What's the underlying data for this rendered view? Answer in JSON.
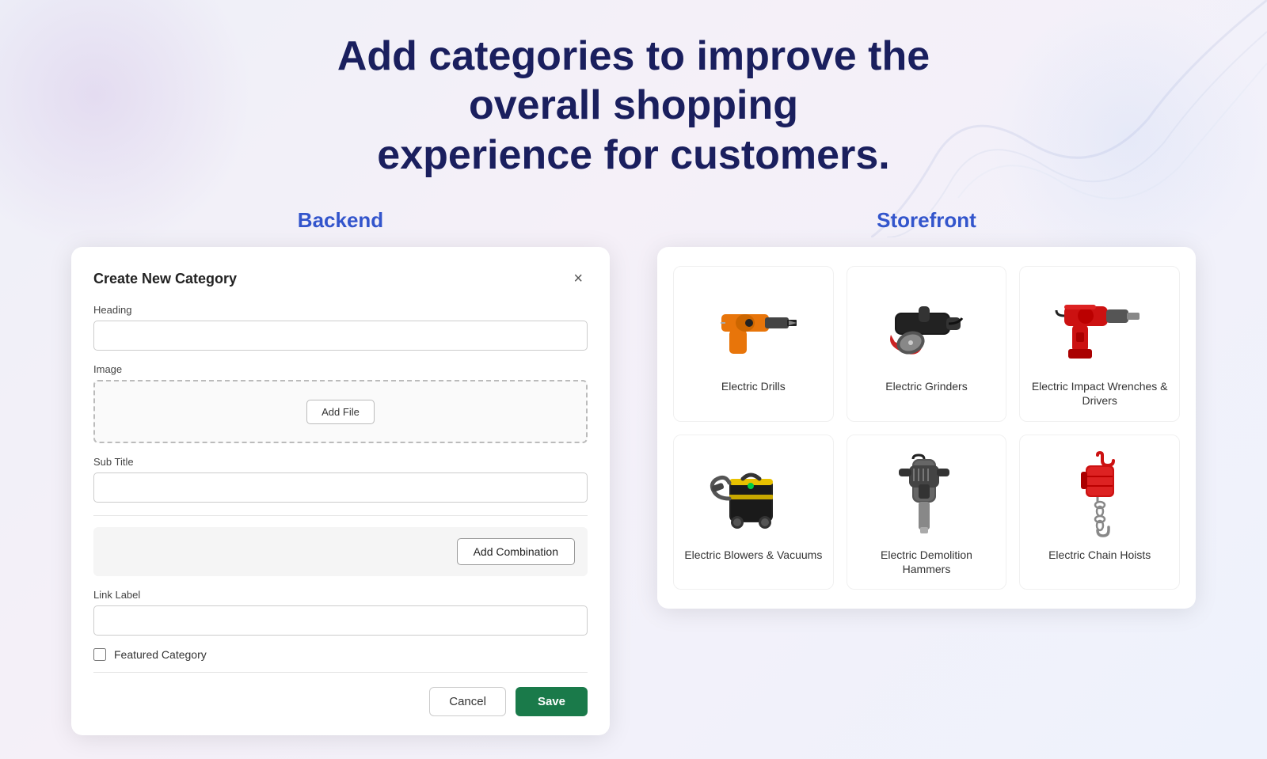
{
  "page": {
    "hero_title_line1": "Add categories to improve the overall shopping",
    "hero_title_line2": "experience for customers."
  },
  "backend": {
    "col_label": "Backend",
    "modal": {
      "title": "Create New Category",
      "heading_label": "Heading",
      "heading_placeholder": "",
      "image_label": "Image",
      "add_file_btn": "Add File",
      "subtitle_label": "Sub Title",
      "subtitle_placeholder": "",
      "add_combination_btn": "Add Combination",
      "link_label_label": "Link Label",
      "link_label_placeholder": "",
      "featured_label": "Featured Category",
      "cancel_btn": "Cancel",
      "save_btn": "Save"
    }
  },
  "storefront": {
    "col_label": "Storefront",
    "categories": [
      {
        "name": "Electric Drills",
        "tool": "drill"
      },
      {
        "name": "Electric Grinders",
        "tool": "grinder"
      },
      {
        "name": "Electric Impact Wrenches & Drivers",
        "tool": "impact_wrench"
      },
      {
        "name": "Electric Blowers & Vacuums",
        "tool": "vacuum"
      },
      {
        "name": "Electric Demolition Hammers",
        "tool": "demolition_hammer"
      },
      {
        "name": "Electric Chain Hoists",
        "tool": "chain_hoist"
      }
    ]
  }
}
